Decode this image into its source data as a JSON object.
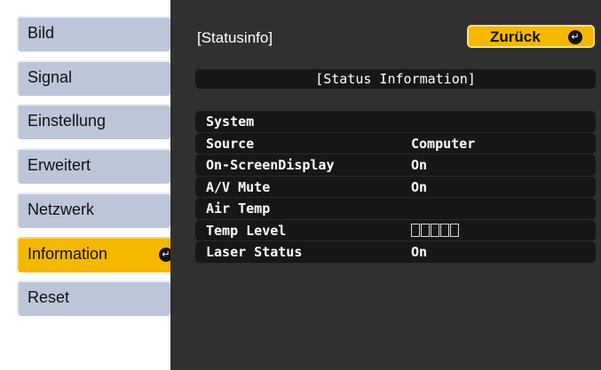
{
  "menu": {
    "items": [
      {
        "label": "Bild"
      },
      {
        "label": "Signal"
      },
      {
        "label": "Einstellung"
      },
      {
        "label": "Erweitert"
      },
      {
        "label": "Netzwerk"
      },
      {
        "label": "Information",
        "selected": true
      },
      {
        "label": "Reset"
      }
    ]
  },
  "panel": {
    "title": "[Statusinfo]",
    "back_label": "Zurück",
    "section_title": "[Status Information]",
    "rows": [
      {
        "key": "System",
        "value": ""
      },
      {
        "key": "Source",
        "value": "Computer"
      },
      {
        "key": "On-ScreenDisplay",
        "value": "On"
      },
      {
        "key": "A/V Mute",
        "value": "On"
      },
      {
        "key": "Air Temp",
        "value": ""
      },
      {
        "key": "Temp Level",
        "value": "",
        "level_boxes": 5
      },
      {
        "key": "Laser Status",
        "value": "On"
      }
    ]
  },
  "colors": {
    "accent": "#f5b700",
    "panel_bg": "#303030",
    "row_bg": "#171717",
    "menu_item_bg": "#bcc6d8"
  },
  "icons": {
    "enter": "enter-icon"
  }
}
